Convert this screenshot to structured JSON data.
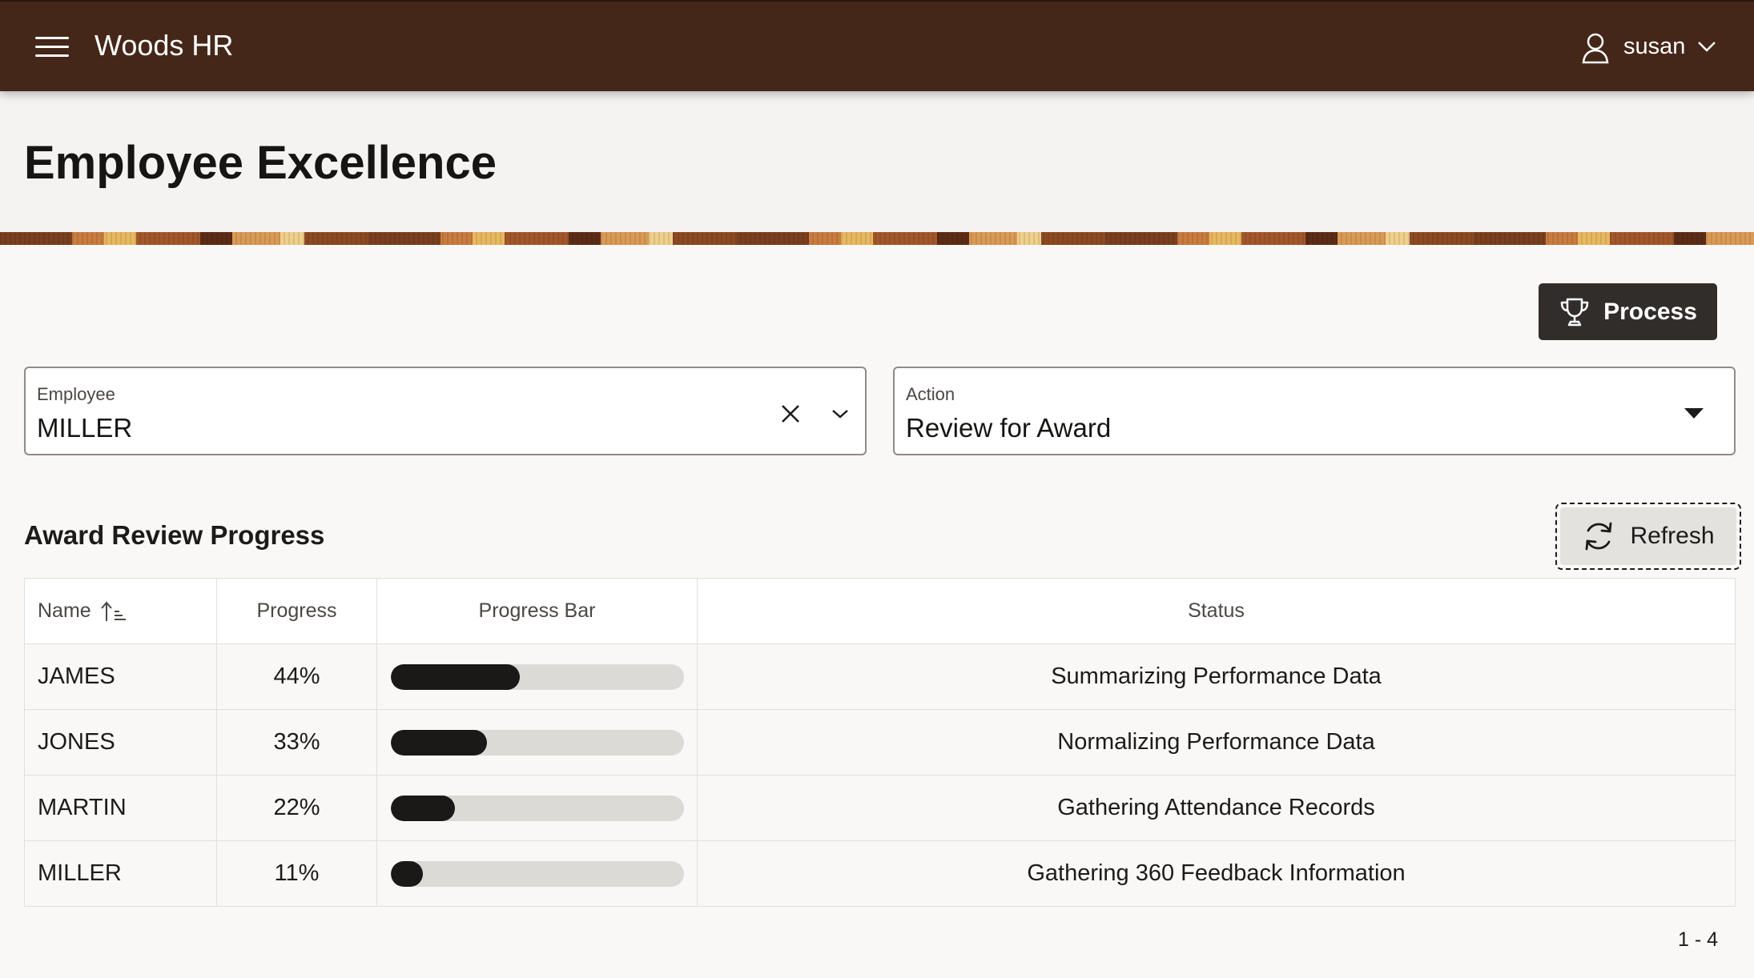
{
  "header": {
    "app_title": "Woods HR",
    "user_name": "susan",
    "menu_icon": "hamburger-menu-icon",
    "user_icon": "user-icon",
    "chevron_icon": "chevron-down-icon",
    "background_color": "#452719"
  },
  "page": {
    "title": "Employee Excellence"
  },
  "toolbar": {
    "process_label": "Process",
    "process_icon": "trophy-icon"
  },
  "fields": {
    "employee": {
      "label": "Employee",
      "value": "MILLER",
      "clear_icon": "close-icon",
      "dropdown_icon": "chevron-down-icon"
    },
    "action": {
      "label": "Action",
      "value": "Review for Award",
      "dropdown_icon": "caret-down-icon"
    }
  },
  "section": {
    "title": "Award Review Progress",
    "refresh_label": "Refresh",
    "refresh_icon": "refresh-icon"
  },
  "table": {
    "columns": [
      "Name",
      "Progress",
      "Progress Bar",
      "Status"
    ],
    "sort": {
      "column": "Name",
      "direction": "ascending"
    },
    "rows": [
      {
        "name": "JAMES",
        "progress_text": "44%",
        "progress": 44,
        "status": "Summarizing Performance Data"
      },
      {
        "name": "JONES",
        "progress_text": "33%",
        "progress": 33,
        "status": "Normalizing Performance Data"
      },
      {
        "name": "MARTIN",
        "progress_text": "22%",
        "progress": 22,
        "status": "Gathering Attendance Records"
      },
      {
        "name": "MILLER",
        "progress_text": "11%",
        "progress": 11,
        "status": "Gathering 360 Feedback Information"
      }
    ]
  },
  "pagination": {
    "text": "1 - 4"
  },
  "colors": {
    "header_bg": "#452719",
    "primary_button": "#312d2a",
    "bar_fill": "#1a1918",
    "bar_track": "#dcdad7"
  }
}
